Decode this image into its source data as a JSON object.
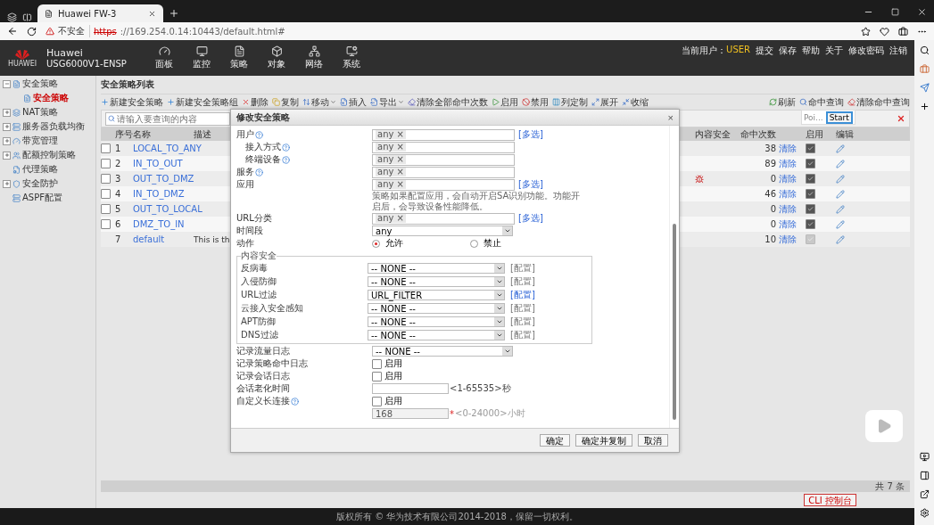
{
  "browser": {
    "tab_title": "Huawei FW-3",
    "security_label": "不安全",
    "url_scheme": "https",
    "url_rest": "://169.254.0.14:10443/default.html#"
  },
  "header": {
    "brand": "HUAWEI",
    "product_name": "Huawei",
    "model": "USG6000V1-ENSP",
    "nav": [
      {
        "label": "面板"
      },
      {
        "label": "监控"
      },
      {
        "label": "策略"
      },
      {
        "label": "对象"
      },
      {
        "label": "网络"
      },
      {
        "label": "系统"
      }
    ],
    "user_label": "当前用户：",
    "user": "USER",
    "links": [
      "提交",
      "保存",
      "帮助",
      "关于",
      "修改密码",
      "注销"
    ]
  },
  "sidebar": {
    "items": [
      {
        "label": "安全策略",
        "kind": "group",
        "expanded": true,
        "selected": false,
        "children": [
          {
            "label": "安全策略",
            "kind": "leaf",
            "selected": true
          }
        ]
      },
      {
        "label": "NAT策略",
        "kind": "group",
        "expanded": false,
        "selected": false
      },
      {
        "label": "服务器负载均衡",
        "kind": "group",
        "expanded": false,
        "selected": false
      },
      {
        "label": "带宽管理",
        "kind": "group",
        "expanded": false,
        "selected": false
      },
      {
        "label": "配额控制策略",
        "kind": "group",
        "expanded": false,
        "selected": false
      },
      {
        "label": "代理策略",
        "kind": "leaf",
        "selected": false
      },
      {
        "label": "安全防护",
        "kind": "group",
        "expanded": false,
        "selected": false
      },
      {
        "label": "ASPF配置",
        "kind": "leaf",
        "selected": false
      }
    ]
  },
  "main": {
    "title": "安全策略列表",
    "toolbar": [
      {
        "label": "新建安全策略",
        "menu": false
      },
      {
        "label": "新建安全策略组",
        "menu": false
      },
      {
        "label": "删除",
        "menu": false
      },
      {
        "label": "复制",
        "menu": false
      },
      {
        "label": "移动",
        "menu": true
      },
      {
        "label": "插入",
        "menu": false
      },
      {
        "label": "导出",
        "menu": true
      },
      {
        "label": "清除全部命中次数",
        "menu": false
      },
      {
        "label": "启用",
        "menu": false
      },
      {
        "label": "禁用",
        "menu": false
      },
      {
        "label": "列定制",
        "menu": false
      },
      {
        "label": "展开",
        "menu": false
      },
      {
        "label": "收缩",
        "menu": false
      }
    ],
    "tools_right": [
      "刷新",
      "命中查询",
      "清除命中查询"
    ],
    "search": {
      "placeholder": "请输入要查询的内容"
    },
    "table": {
      "columns": [
        "序号",
        "名称",
        "描述",
        "内容安全",
        "命中次数",
        "启用",
        "编辑"
      ],
      "rows": [
        {
          "index": "1",
          "checked": false,
          "name": "LOCAL_TO_ANY",
          "content_security": false,
          "hits": "38",
          "clear": "清除",
          "enabled": true,
          "disabled": false
        },
        {
          "index": "2",
          "checked": false,
          "name": "IN_TO_OUT",
          "content_security": false,
          "hits": "89",
          "clear": "清除",
          "enabled": true,
          "disabled": false
        },
        {
          "index": "3",
          "checked": false,
          "name": "OUT_TO_DMZ",
          "content_security": true,
          "hits": "0",
          "clear": "清除",
          "enabled": true,
          "disabled": false
        },
        {
          "index": "4",
          "checked": false,
          "name": "IN_TO_DMZ",
          "content_security": false,
          "hits": "46",
          "clear": "清除",
          "enabled": true,
          "disabled": false
        },
        {
          "index": "5",
          "checked": false,
          "name": "OUT_TO_LOCAL",
          "content_security": false,
          "hits": "0",
          "clear": "清除",
          "enabled": true,
          "disabled": false
        },
        {
          "index": "6",
          "checked": false,
          "name": "DMZ_TO_IN",
          "content_security": false,
          "hits": "0",
          "clear": "清除",
          "enabled": true,
          "disabled": false
        },
        {
          "index": "7",
          "name": "default",
          "description": "This is th",
          "content_security": false,
          "hits": "10",
          "clear": "清除",
          "enabled": true,
          "disabled": true
        }
      ]
    },
    "total": "共 7 条",
    "cli": "CLI 控制台",
    "copyright": "版权所有 © 华为技术有限公司2014-2018，保留一切权利。"
  },
  "popup": {
    "title": "Poi...",
    "button": "Start"
  },
  "dialog": {
    "title": "修改安全策略",
    "close": "×",
    "fields": [
      {
        "kind": "tags",
        "label": "用户",
        "help": true,
        "indent": false,
        "tag": "any",
        "remove": "×",
        "link": "[多选]"
      },
      {
        "kind": "tags",
        "label": "接入方式",
        "help": true,
        "indent": true,
        "tag": "any",
        "remove": "×"
      },
      {
        "kind": "tags",
        "label": "终端设备",
        "help": true,
        "indent": true,
        "tag": "any",
        "remove": "×"
      },
      {
        "kind": "tags",
        "label": "服务",
        "help": true,
        "indent": false,
        "tag": "any",
        "remove": "×"
      },
      {
        "kind": "tags",
        "label": "应用",
        "help": false,
        "indent": false,
        "tag": "any",
        "remove": "×",
        "link": "[多选]"
      },
      {
        "kind": "note",
        "text": "策略如果配置应用，会自动开启SA识别功能。功能开启后，会导致设备性能降低。"
      },
      {
        "kind": "tags",
        "label": "URL分类",
        "help": false,
        "indent": false,
        "tag": "any",
        "remove": "×",
        "link": "[多选]"
      },
      {
        "kind": "select",
        "label": "时间段",
        "value": "any"
      },
      {
        "kind": "radio",
        "label": "动作",
        "options": [
          {
            "label": "允许",
            "selected": true
          },
          {
            "label": "禁止",
            "selected": false
          }
        ]
      },
      {
        "kind": "group",
        "label": "内容安全",
        "items": [
          {
            "label": "反病毒",
            "value": "-- NONE --",
            "link": "[配置]",
            "disabled": true
          },
          {
            "label": "入侵防御",
            "value": "-- NONE --",
            "link": "[配置]",
            "disabled": true
          },
          {
            "label": "URL过滤",
            "value": "URL_FILTER",
            "link": "[配置]",
            "disabled": false
          },
          {
            "label": "云接入安全感知",
            "value": "-- NONE --",
            "link": "[配置]",
            "disabled": true
          },
          {
            "label": "APT防御",
            "value": "-- NONE --",
            "link": "[配置]",
            "disabled": true
          },
          {
            "label": "DNS过滤",
            "value": "-- NONE --",
            "link": "[配置]",
            "disabled": true
          }
        ]
      },
      {
        "kind": "select",
        "label": "记录流量日志",
        "value": "-- NONE --"
      },
      {
        "kind": "checkbox",
        "label": "记录策略命中日志",
        "option": "启用",
        "checked": false
      },
      {
        "kind": "checkbox",
        "label": "记录会话日志",
        "option": "启用",
        "checked": false
      },
      {
        "kind": "input",
        "label": "会话老化时间",
        "hint": "<1-65535>秒",
        "disabled": false
      },
      {
        "kind": "checkbox",
        "label": "自定义长连接",
        "help": true,
        "option": "启用",
        "checked": false
      },
      {
        "kind": "input",
        "value": "168",
        "required_mark": "*",
        "hint": "<0-24000>小时",
        "disabled": true
      }
    ],
    "buttons": [
      "确定",
      "确定并复制",
      "取消"
    ]
  }
}
